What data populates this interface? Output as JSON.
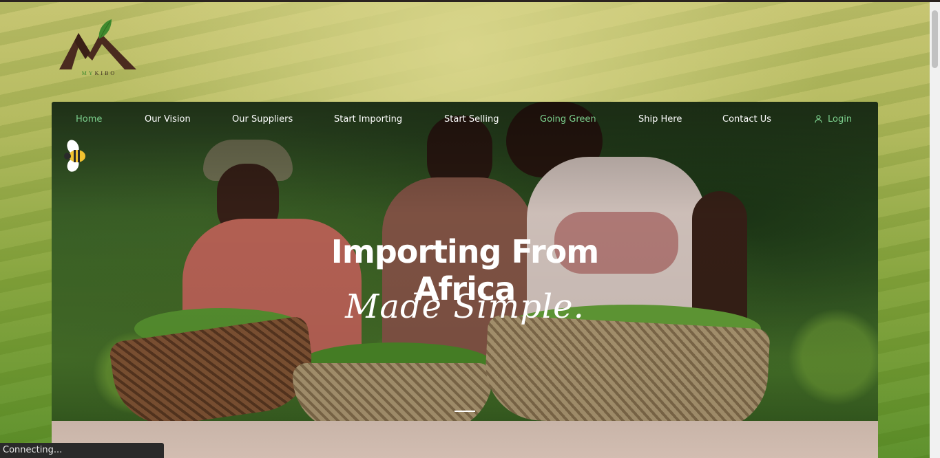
{
  "logo": {
    "prefix": "MY",
    "suffix": "KIBO"
  },
  "nav": {
    "items": [
      {
        "label": "Home"
      },
      {
        "label": "Our Vision"
      },
      {
        "label": "Our Suppliers"
      },
      {
        "label": "Start Importing"
      },
      {
        "label": "Start Selling"
      },
      {
        "label": "Going Green"
      },
      {
        "label": "Ship Here"
      },
      {
        "label": "Contact Us"
      }
    ],
    "login": "Login",
    "accent_color": "#7cd08e"
  },
  "hero": {
    "line1": "Importing From",
    "line2": "Africa",
    "tagline": "Made Simple."
  },
  "status_bar": {
    "text": "Connecting..."
  },
  "icons": [
    "mykibo-logo-icon",
    "bee-icon",
    "user-icon"
  ]
}
